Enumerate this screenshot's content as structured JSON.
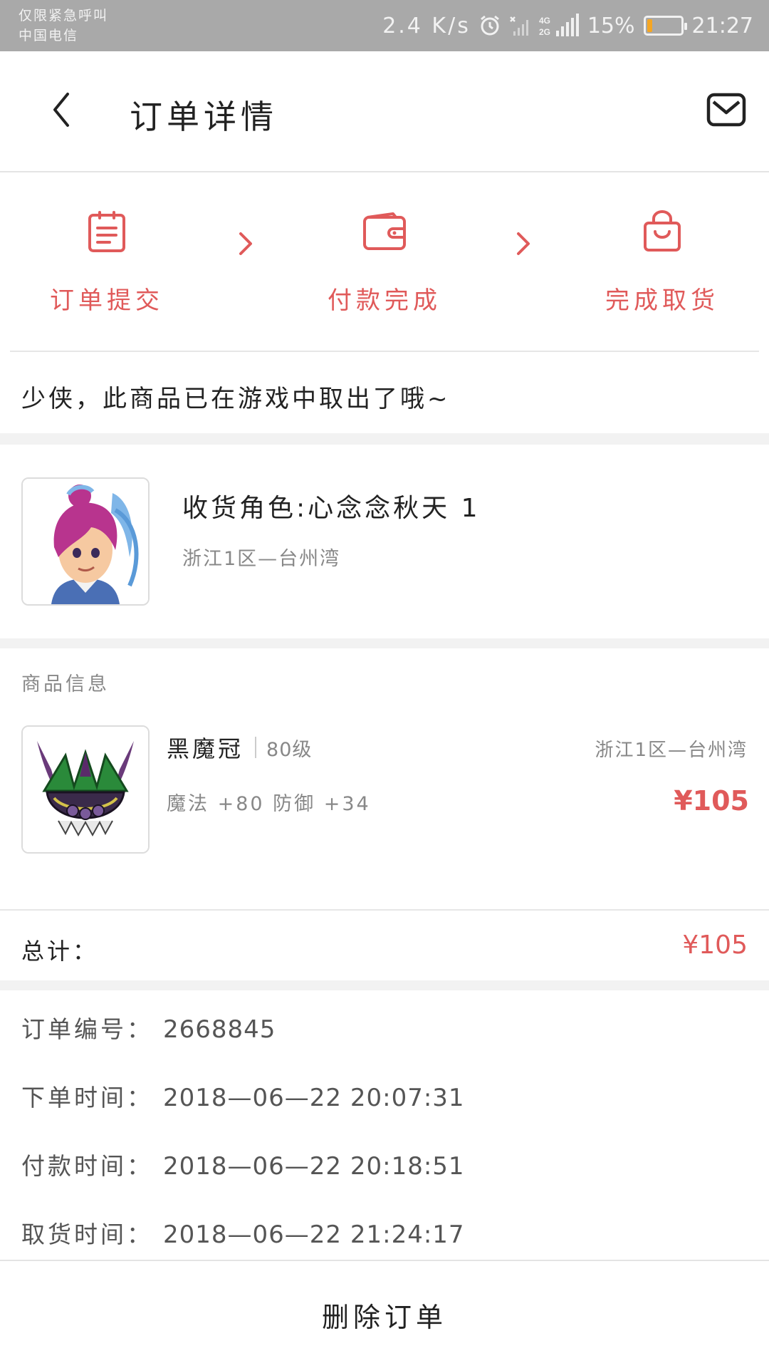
{
  "status_bar": {
    "line1": "仅限紧急呼叫",
    "line2": "中国电信",
    "speed": "2.4 K/s",
    "network": "4G/2G",
    "battery": "15%",
    "battery_level": 0.15,
    "time": "21:27",
    "icons": [
      "alarm-icon",
      "no-sim-signal-icon",
      "signal-icon",
      "battery-icon"
    ]
  },
  "navbar": {
    "back_icon": "chevron-left-icon",
    "title": "订单详情",
    "mail_icon": "mail-icon"
  },
  "steps": [
    {
      "label": "订单提交",
      "icon": "clipboard-icon"
    },
    {
      "label": "付款完成",
      "icon": "wallet-icon"
    },
    {
      "label": "完成取货",
      "icon": "shopping-bag-icon"
    }
  ],
  "accent_color": "#e05a5a",
  "message": "少侠，此商品已在游戏中取出了哦~",
  "receiver": {
    "name": "收货角色:心念念秋天 1",
    "server": "浙江1区—台州湾",
    "avatar": "character-avatar"
  },
  "product": {
    "section_label": "商品信息",
    "name": "黑魔冠",
    "level": "80级",
    "stats": "魔法 +80 防御 +34",
    "server": "浙江1区—台州湾",
    "price": "¥105",
    "image": "helmet-item-image"
  },
  "total": {
    "label": "总计：",
    "value": "¥105"
  },
  "order_info": [
    {
      "label": "订单编号：",
      "value": "2668845"
    },
    {
      "label": "下单时间：",
      "value": "2018—06—22  20:07:31"
    },
    {
      "label": "付款时间：",
      "value": "2018—06—22  20:18:51"
    },
    {
      "label": "取货时间：",
      "value": "2018—06—22  21:24:17"
    }
  ],
  "bottom": {
    "delete_label": "删除订单"
  }
}
